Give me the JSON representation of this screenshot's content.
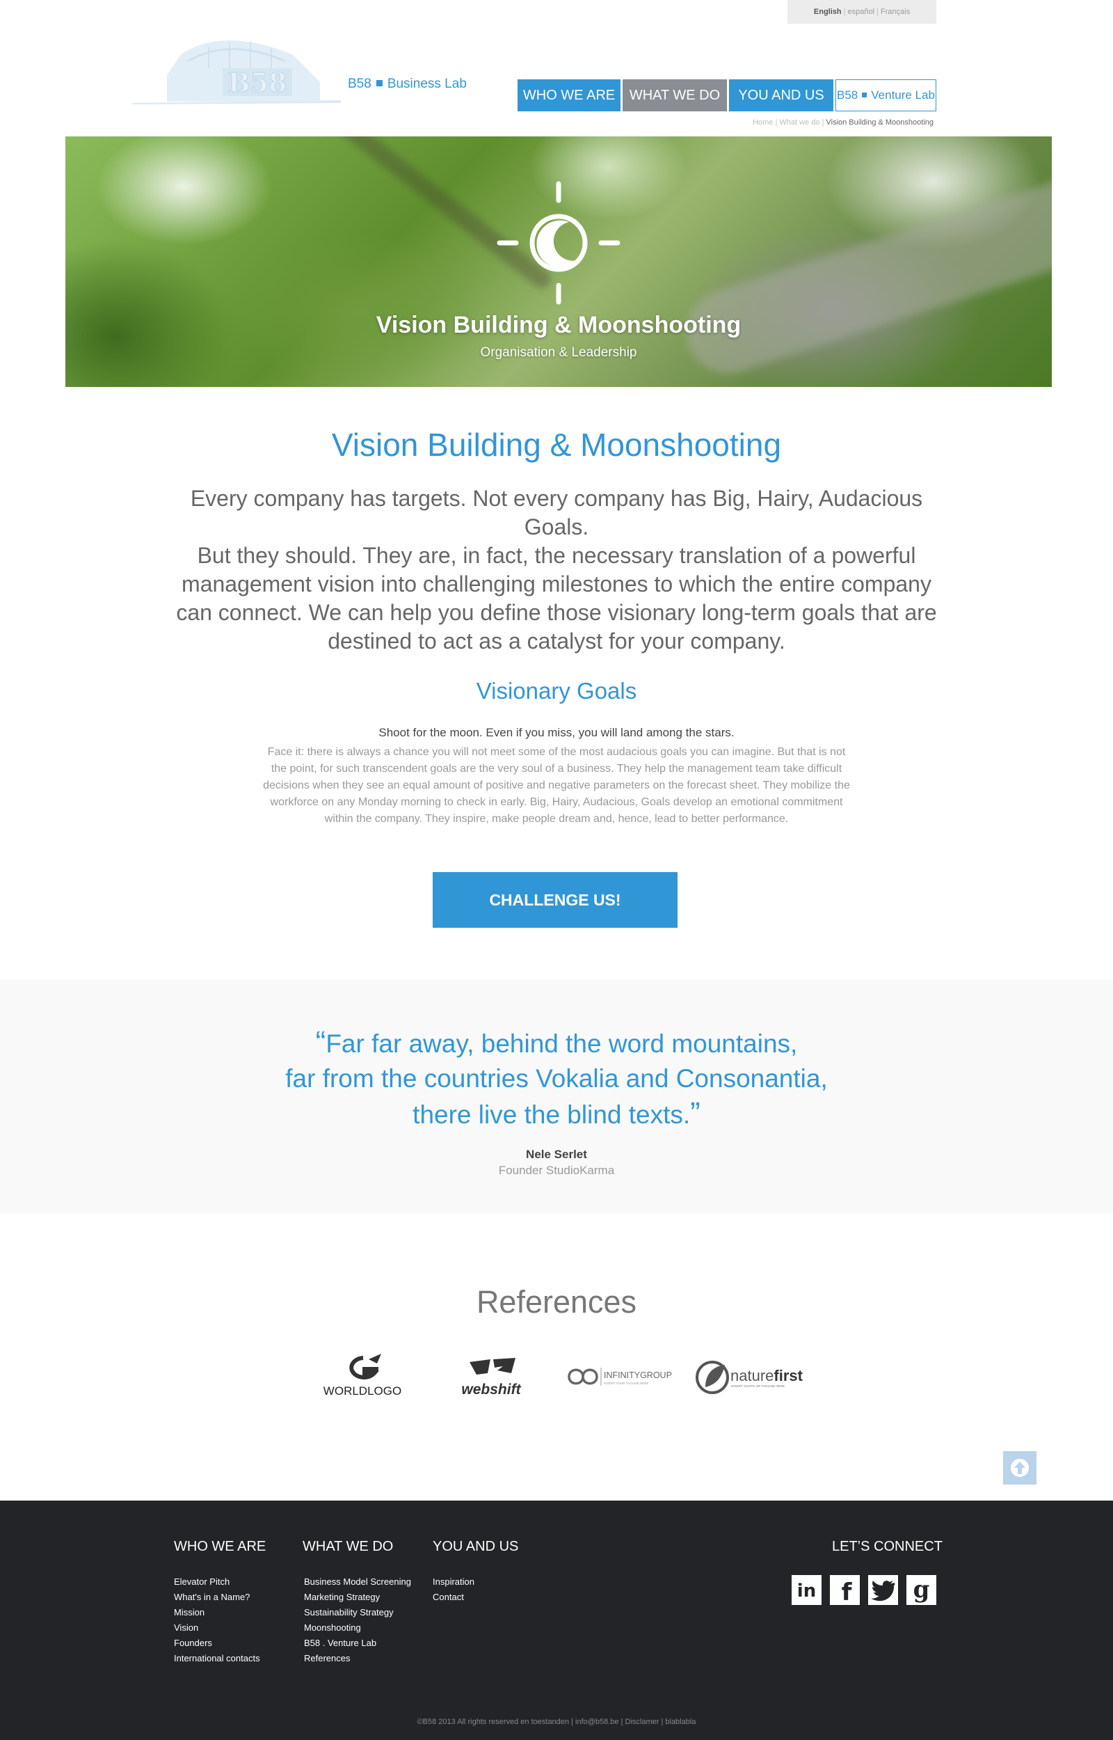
{
  "languages": {
    "english": "English",
    "spanish": "español",
    "french": "Français",
    "separator": "|"
  },
  "logo": {
    "brand": "B58",
    "tagline": "Business Lab",
    "emblem_text": "B58"
  },
  "nav": {
    "who": "WHO WE ARE",
    "what": "WHAT WE DO",
    "you": "YOU AND US",
    "venture_brand": "B58",
    "venture_label": "Venture Lab"
  },
  "breadcrumb": {
    "home": "Home",
    "what": "What we do",
    "current": "Vision Building & Moonshooting",
    "separator": "|"
  },
  "hero": {
    "title": "Vision Building & Moonshooting",
    "subtitle": "Organisation & Leadership",
    "icon": "sun-moon-icon"
  },
  "main": {
    "title": "Vision Building & Moonshooting",
    "intro_lines": [
      "Every company has targets. Not every company has Big, Hairy, Audacious Goals.",
      "But they should. They are, in fact, the necessary translation of a powerful",
      "management vision into challenging milestones to which the entire company",
      "can connect. We can help you define those visionary long-term goals that are",
      "destined to act as a catalyst for your company."
    ],
    "goals_title": "Visionary Goals",
    "goals_lead": "Shoot for the moon. Even if you miss, you will land among the stars.",
    "goals_lines": [
      "Face it: there is always a chance you will not meet some of the most audacious goals you can imagine. But that is not",
      "the point, for such transcendent goals are the very soul of a business. They help the management team take difficult",
      "decisions when they see an equal amount of positive and negative parameters on the forecast sheet. They mobilize the",
      "workforce on any Monday morning to check in early. Big, Hairy, Audacious, Goals develop an emotional commitment",
      "within the company. They inspire, make people dream and, hence, lead to better performance."
    ],
    "cta": "CHALLENGE US!"
  },
  "quote": {
    "open": "“",
    "close": "”",
    "lines": [
      "Far far away, behind the word mountains,",
      "far from the countries Vokalia and Consonantia,",
      "there live the blind texts."
    ],
    "author": "Nele Serlet",
    "role": "Founder StudioKarma"
  },
  "references": {
    "title": "References",
    "logos": [
      {
        "name": "worldlogo-logo",
        "text": "WORLDLOGO"
      },
      {
        "name": "webshift-logo",
        "text": "webshift"
      },
      {
        "name": "infinitygroup-logo",
        "text": "INFINITYGROUP",
        "tagline": "INSERT YOUR TAGLINE HERE"
      },
      {
        "name": "naturefirst-logo",
        "text_light": "nature",
        "text_bold": "first",
        "tagline": "INSERT GUOTE OR TAGLINE HERE"
      }
    ]
  },
  "footer": {
    "who_title": "WHO WE ARE",
    "who_items": [
      "Elevator Pitch",
      "What's in a Name?",
      "Mission",
      "Vision",
      "Founders",
      "International contacts"
    ],
    "what_title": "WHAT WE DO",
    "what_items": [
      "Business Model Screening",
      "Marketing Strategy",
      "Sustainability Strategy",
      "Moonshooting",
      "B58 . Venture Lab",
      "References"
    ],
    "you_title": "YOU AND US",
    "you_items": [
      "Inspiration",
      "Contact"
    ],
    "connect_title": "LET’S CONNECT",
    "social": {
      "linkedin": "in",
      "facebook": "f",
      "twitter": "twitter-icon",
      "google": "g"
    },
    "copyright": "©B58 2013 All rights reserved en toestanden | info@b58.be | Disclamer | blablabla"
  },
  "colors": {
    "accent": "#3096d6",
    "nav_gray": "#8a8d93",
    "footer_bg": "#232427"
  }
}
